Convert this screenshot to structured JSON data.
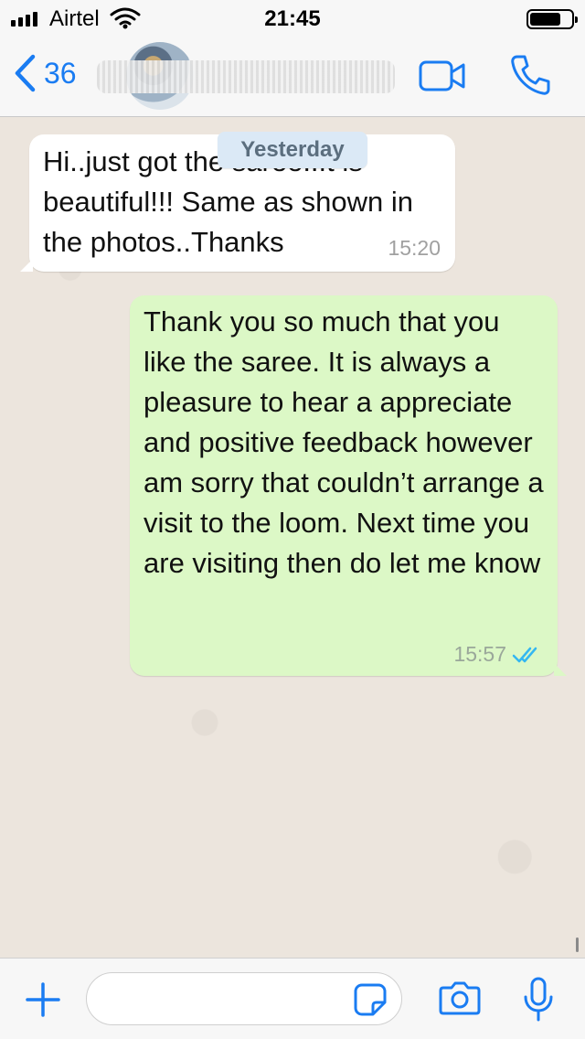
{
  "status_bar": {
    "carrier": "Airtel",
    "time": "21:45",
    "battery_level": 0.75
  },
  "header": {
    "back_count": "36",
    "contact_name": ""
  },
  "chat": {
    "date_divider": "Yesterday",
    "messages": [
      {
        "direction": "incoming",
        "text": "Hi..just got the saree..It is beautiful!!! Same as shown in the photos..Thanks",
        "time": "15:20"
      },
      {
        "direction": "outgoing",
        "text": "Thank you so much that you like the saree. It is always a pleasure to hear a appreciate and positive feedback however am sorry that couldn’t arrange a visit to the loom. Next time you are visiting then do let me know",
        "time": "15:57",
        "status": "read"
      }
    ]
  },
  "input_bar": {
    "placeholder": ""
  },
  "colors": {
    "accent": "#1a7cf2",
    "incoming_bubble": "#ffffff",
    "outgoing_bubble": "#dcf8c6",
    "read_ticks": "#34b7f1",
    "chat_background": "#ece5dd"
  },
  "icons": [
    "signal-icon",
    "wifi-icon",
    "battery-icon",
    "back-chevron-icon",
    "video-call-icon",
    "phone-call-icon",
    "double-check-icon",
    "plus-icon",
    "sticker-icon",
    "camera-icon",
    "microphone-icon"
  ]
}
